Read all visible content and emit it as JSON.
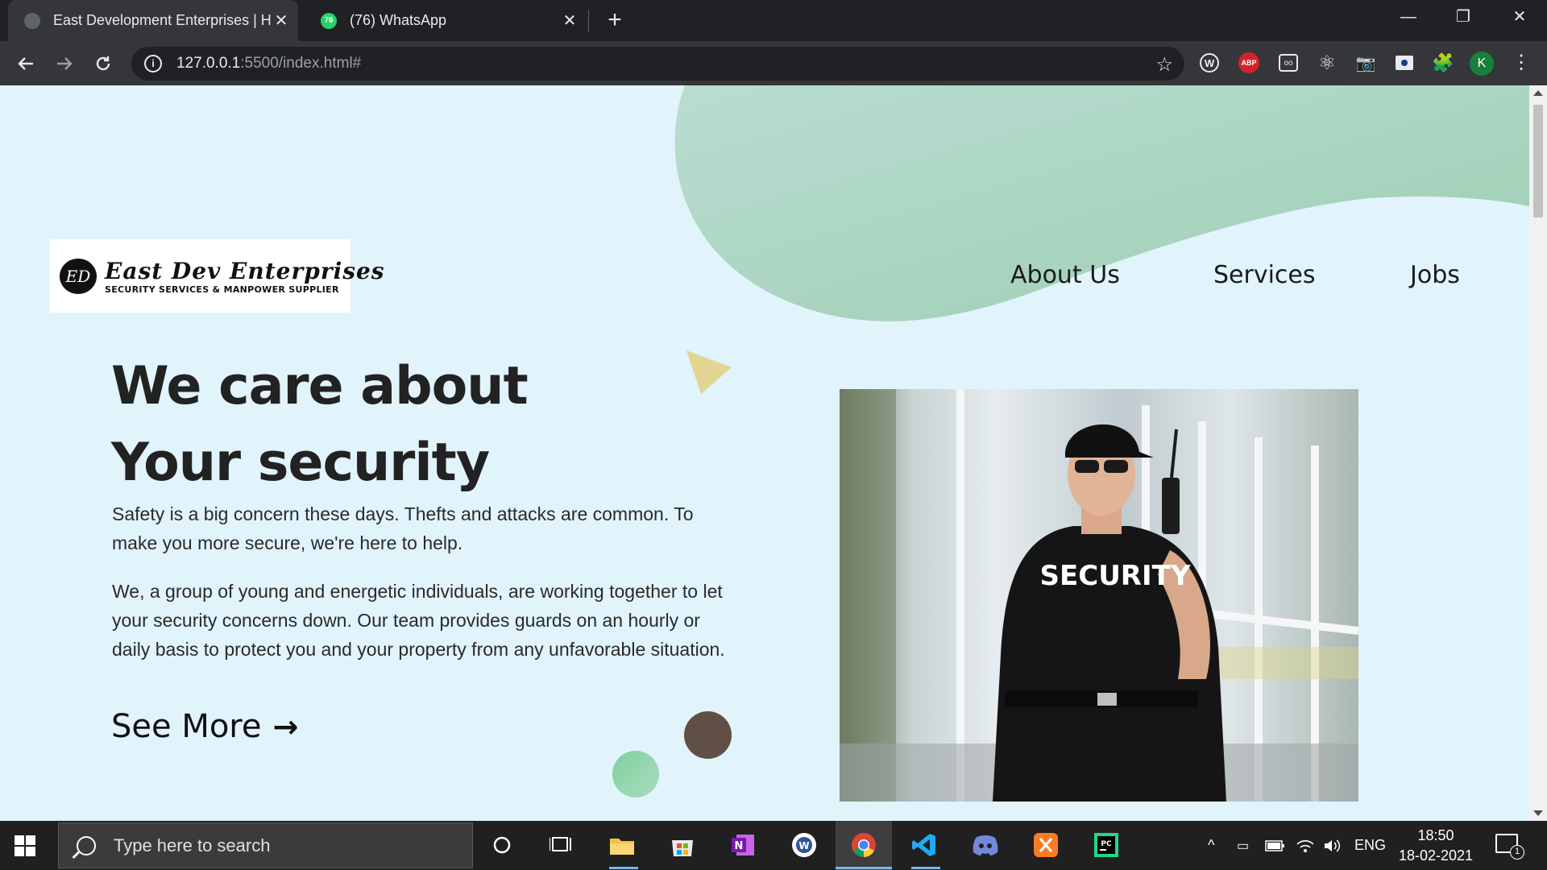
{
  "browser": {
    "tabs": [
      {
        "title": "East Development Enterprises | H",
        "active": true,
        "favicon": "globe-icon"
      },
      {
        "title": "(76) WhatsApp",
        "active": false,
        "favicon": "whatsapp-icon",
        "badge": "76"
      }
    ],
    "url_host": "127.0.0.1",
    "url_rest": ":5500/index.html#",
    "profile_initial": "K",
    "extensions": {
      "w": "W",
      "abp": "ABP",
      "ghost": "oo"
    }
  },
  "site": {
    "logo": {
      "monogram": "ED",
      "name": "East Dev Enterprises",
      "tagline": "SECURITY SERVICES & MANPOWER SUPPLIER"
    },
    "nav": [
      "About Us",
      "Services",
      "Jobs"
    ],
    "hero": {
      "title_line1": "We care about",
      "title_line2": "Your security",
      "para1": "Safety is a big concern these days. Thefts and attacks are common. To make you more secure, we're here to help.",
      "para2": "We, a group of young and energetic individuals, are working together to let your security concerns down. Our team provides guards on an hourly or daily basis to protect you and your property from any unfavorable situation.",
      "cta": "See More",
      "photo_shirt_text": "SECURITY"
    },
    "colors": {
      "background": "#e1f3fb",
      "blob": "#a9d4c0",
      "triangle": "#e2d592",
      "dot_brown": "#5f4f45",
      "dot_green": "#8fd4aa"
    }
  },
  "taskbar": {
    "search_placeholder": "Type here to search",
    "time": "18:50",
    "date": "18-02-2021",
    "language": "ENG",
    "notification_count": "1",
    "apps": [
      "cortana-icon",
      "task-view-icon",
      "file-explorer-icon",
      "microsoft-store-icon",
      "onenote-icon",
      "word-online-icon",
      "chrome-icon",
      "vscode-icon",
      "discord-icon",
      "xampp-icon",
      "pycharm-icon"
    ]
  }
}
